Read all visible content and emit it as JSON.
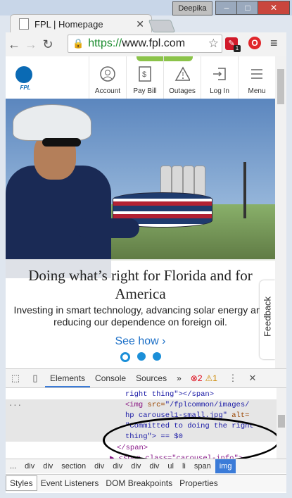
{
  "browser": {
    "tab_title": "FPL | Homepage",
    "user_name": "Deepika",
    "url_scheme": "https://",
    "url_host": "www.fpl.com",
    "ext_badge": "1"
  },
  "site": {
    "logo_text": "FPL",
    "nav": [
      {
        "label": "Account"
      },
      {
        "label": "Pay Bill"
      },
      {
        "label": "Outages"
      },
      {
        "label": "Log In"
      },
      {
        "label": "Menu"
      }
    ],
    "hero": {
      "title": "Doing what’s right for Florida and for America",
      "subtitle": "Investing in smart technology, advancing solar energy and reducing our dependence on foreign oil.",
      "link": "See how ›"
    },
    "feedback_label": "Feedback"
  },
  "devtools": {
    "tabs": [
      "Elements",
      "Console",
      "Sources",
      "»"
    ],
    "errors": "2",
    "warnings": "1",
    "code": {
      "line1": "right thing\"></span>",
      "line2_tag": "<img ",
      "line2_attr": "src=",
      "line2_val": "\"/fplcommon/images/",
      "line3_val": "hp carousel1-small.jpg\"",
      "line3_attr": " alt=",
      "line4_val": "\"Committed to doing the right",
      "line5": "thing\"> == $0",
      "line6": "</span>",
      "line7": "▶ <span class=\"carousel-info\">"
    },
    "breadcrumbs": [
      "...",
      "div",
      "div",
      "section",
      "div",
      "div",
      "div",
      "div",
      "ul",
      "li",
      "span",
      "img"
    ],
    "subtabs": [
      "Styles",
      "Event Listeners",
      "DOM Breakpoints",
      "Properties"
    ]
  }
}
